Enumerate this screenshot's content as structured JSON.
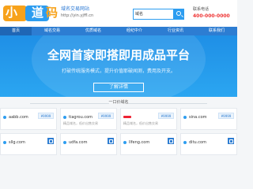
{
  "header": {
    "logo_chars": [
      "小",
      "道",
      "码"
    ],
    "slogan": "域名交易网站",
    "site_url": "http://yin.yjffl.cn",
    "search": {
      "value": "域名",
      "placeholder": ""
    },
    "hotline_label": "联系电话",
    "hotline_number": "400-000-0000"
  },
  "nav": {
    "items": [
      "首页",
      "域名交易",
      "优质域名",
      "经纪中介",
      "行业资讯",
      "联系我们"
    ],
    "active": 0
  },
  "banner": {
    "title": "全网首家即搭即用成品平台",
    "subtitle": "打破传统服务模式，提升价值耶破闻测，费用及开支。",
    "button": "了解详情"
  },
  "section": {
    "title": "一口价域名"
  },
  "cards": [
    {
      "domain": "aabb.com",
      "desc": "",
      "price": "¥9999"
    },
    {
      "domain": "tiagrou.com",
      "desc": "精品域名，低价出售交易",
      "price": "¥9999"
    },
    {
      "domain": "",
      "desc": "精品域名，低价出售交易",
      "price": "¥9999",
      "redacted": true
    },
    {
      "domain": "sina.com",
      "desc": "",
      "price": "¥9999"
    },
    {
      "domain": "sllg.com",
      "desc": "",
      "price": ""
    },
    {
      "domain": "udfa.com",
      "desc": "",
      "price": ""
    },
    {
      "domain": "llfeng.com",
      "desc": "",
      "price": ""
    },
    {
      "domain": "ditu.com",
      "desc": "",
      "price": ""
    }
  ],
  "colors": {
    "primary": "#2d7dd2",
    "banner_top": "#1f8fe6",
    "banner_bottom": "#2ba6f1",
    "accent_orange": "#f7a21b"
  }
}
